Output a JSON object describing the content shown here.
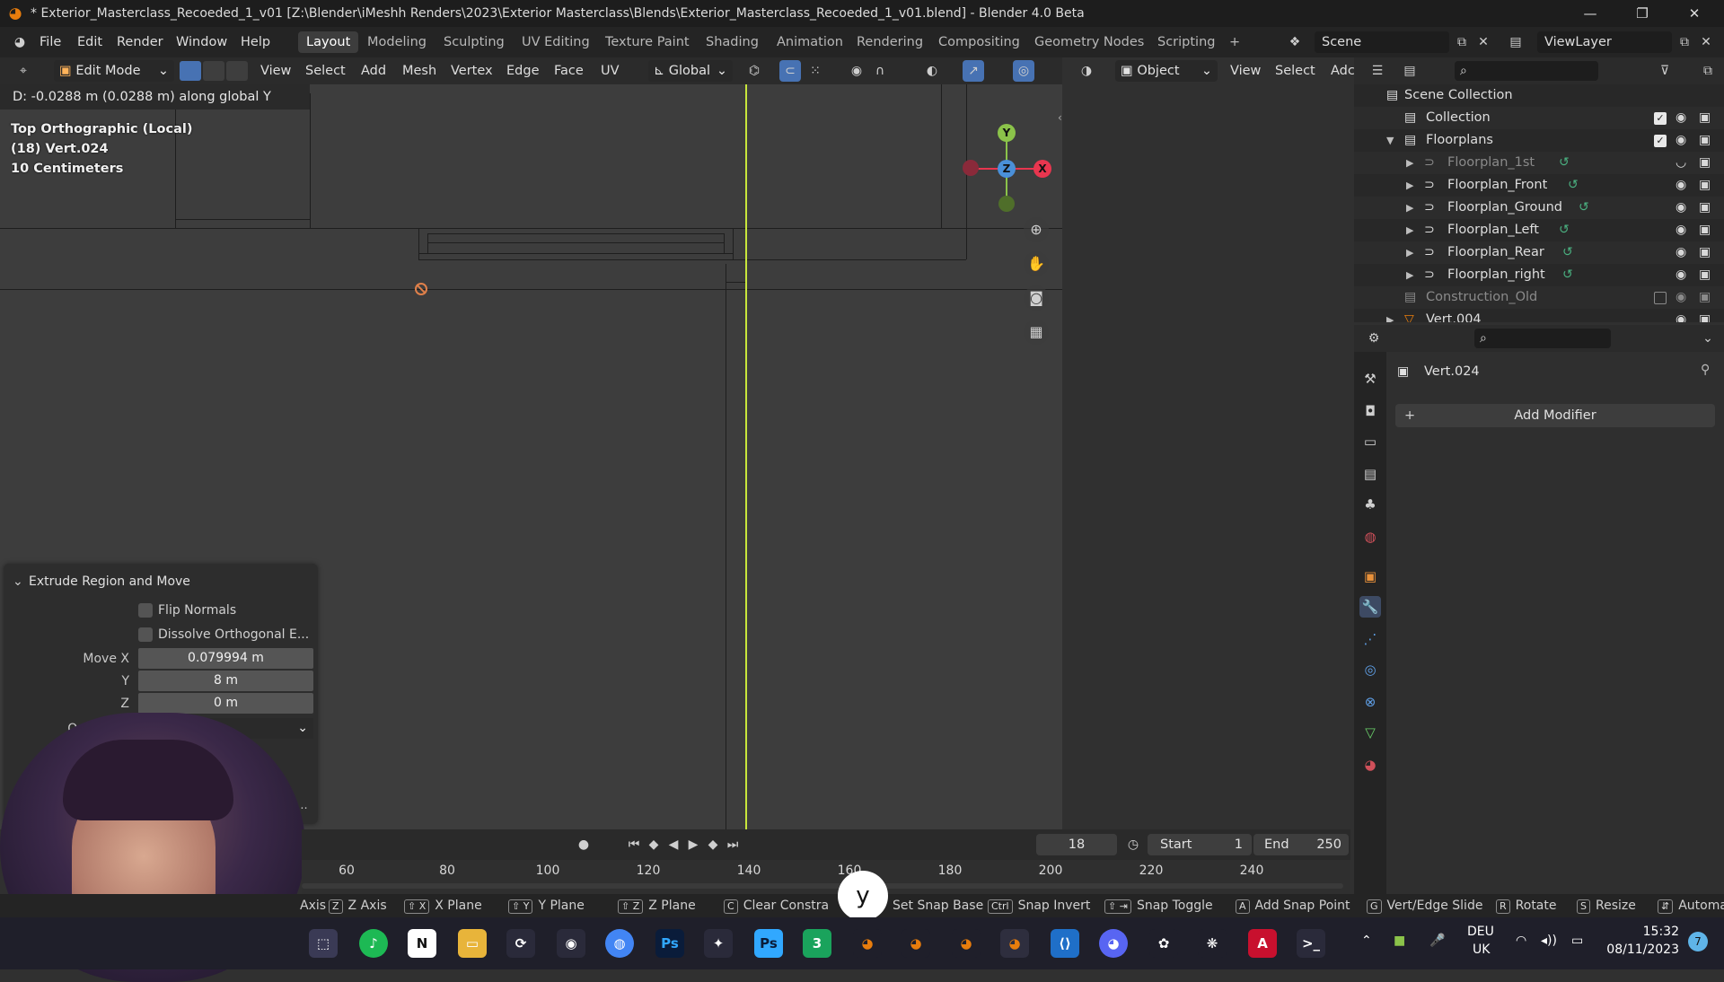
{
  "window": {
    "title": "* Exterior_Masterclass_Recoeded_1_v01 [Z:\\Blender\\iMeshh Renders\\2023\\Exterior Masterclass\\Blends\\Exterior_Masterclass_Recoeded_1_v01.blend] - Blender 4.0 Beta"
  },
  "menu": {
    "items": [
      "File",
      "Edit",
      "Render",
      "Window",
      "Help"
    ],
    "workspaces": [
      "Layout",
      "Modeling",
      "Sculpting",
      "UV Editing",
      "Texture Paint",
      "Shading",
      "Animation",
      "Rendering",
      "Compositing",
      "Geometry Nodes",
      "Scripting"
    ],
    "add_tab": "+",
    "scene": "Scene",
    "view_layer": "ViewLayer"
  },
  "viewport_header": {
    "mode": "Edit Mode",
    "menus": [
      "View",
      "Select",
      "Add",
      "Mesh",
      "Vertex",
      "Edge",
      "Face",
      "UV"
    ],
    "orientation": "Global",
    "object_mode_label": "Object",
    "right_menus": [
      "View",
      "Select",
      "Adc"
    ]
  },
  "viewport": {
    "status_text": "D: -0.0288 m (0.0288 m) along global Y",
    "view_name": "Top Orthographic (Local)",
    "object_label": "(18) Vert.024",
    "scale_label": "10 Centimeters",
    "gizmo": {
      "y": "Y",
      "z": "Z",
      "x": "X"
    }
  },
  "operator_panel": {
    "title": "Extrude Region and Move",
    "flip_normals": "Flip Normals",
    "dissolve": "Dissolve Orthogonal E...",
    "move_x_label": "Move X",
    "move_x": "0.079994 m",
    "y_label": "Y",
    "move_y": "8 m",
    "z_label": "Z",
    "move_z": "0 m",
    "partial_label": "Or",
    "partial_bottom": "n..."
  },
  "timeline": {
    "current_frame": "18",
    "start_label": "Start",
    "start": "1",
    "end_label": "End",
    "end": "250",
    "ticks": [
      "60",
      "80",
      "100",
      "120",
      "140",
      "160",
      "180",
      "200",
      "220",
      "240"
    ]
  },
  "keymap_bar": {
    "items": [
      {
        "key": "",
        "label": "Axis"
      },
      {
        "key": "Z",
        "label": "Z Axis"
      },
      {
        "key": "⇧ X",
        "label": "X Plane"
      },
      {
        "key": "⇧ Y",
        "label": "Y Plane"
      },
      {
        "key": "⇧ Z",
        "label": "Z Plane"
      },
      {
        "key": "C",
        "label": "Clear Constra"
      },
      {
        "key": "",
        "label": "Set Snap Base"
      },
      {
        "key": "Ctrl",
        "label": "Snap Invert"
      },
      {
        "key": "⇧ ⇥",
        "label": "Snap Toggle"
      },
      {
        "key": "A",
        "label": "Add Snap Point"
      },
      {
        "key": "G",
        "label": "Vert/Edge Slide"
      },
      {
        "key": "R",
        "label": "Rotate"
      },
      {
        "key": "S",
        "label": "Resize"
      },
      {
        "key": "",
        "label": "Automa"
      }
    ],
    "typed_key": "y"
  },
  "outliner": {
    "root": "Scene Collection",
    "rows": [
      {
        "name": "Collection",
        "level": 1,
        "checked": true
      },
      {
        "name": "Floorplans",
        "level": 1,
        "checked": true
      },
      {
        "name": "Floorplan_1st",
        "level": 2,
        "dim": true
      },
      {
        "name": "Floorplan_Front",
        "level": 2
      },
      {
        "name": "Floorplan_Ground",
        "level": 2
      },
      {
        "name": "Floorplan_Left",
        "level": 2
      },
      {
        "name": "Floorplan_Rear",
        "level": 2
      },
      {
        "name": "Floorplan_right",
        "level": 2
      },
      {
        "name": "Construction_Old",
        "level": 1,
        "dim": true
      },
      {
        "name": "Vert.004",
        "level": 1
      }
    ]
  },
  "properties": {
    "object_name": "Vert.024",
    "add_modifier": "Add Modifier"
  },
  "taskbar": {
    "lang_top": "DEU",
    "lang_bottom": "UK",
    "time": "15:32",
    "date": "08/11/2023",
    "notif_count": "7"
  },
  "colors": {
    "accent_blue": "#4772b3",
    "y_axis_line": "#c8e63c",
    "gizmo_x": "#e8364f",
    "gizmo_y": "#8bc34a",
    "gizmo_z": "#4a90d9"
  }
}
